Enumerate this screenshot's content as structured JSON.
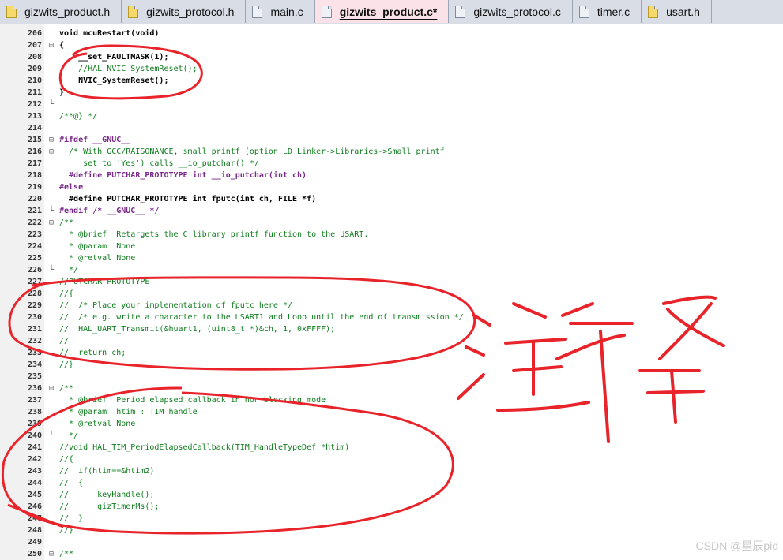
{
  "tabs": [
    {
      "label": "gizwits_product.h",
      "type": "h",
      "active": false
    },
    {
      "label": "gizwits_protocol.h",
      "type": "h",
      "active": false
    },
    {
      "label": "main.c",
      "type": "c",
      "active": false
    },
    {
      "label": "gizwits_product.c*",
      "type": "c",
      "active": true
    },
    {
      "label": "gizwits_protocol.c",
      "type": "c",
      "active": false
    },
    {
      "label": "timer.c",
      "type": "c",
      "active": false
    },
    {
      "label": "usart.h",
      "type": "h",
      "active": false
    }
  ],
  "lines": [
    {
      "n": "206",
      "fold": "",
      "code": "void mcuRestart(void)",
      "cls": "code"
    },
    {
      "n": "207",
      "fold": "⊟",
      "code": "{",
      "cls": "code"
    },
    {
      "n": "208",
      "fold": "",
      "code": "    __set_FAULTMASK(1);",
      "cls": "code"
    },
    {
      "n": "209",
      "fold": "",
      "code": "    //HAL_NVIC_SystemReset();",
      "cls": "cm"
    },
    {
      "n": "210",
      "fold": "",
      "code": "    NVIC_SystemReset();",
      "cls": "code"
    },
    {
      "n": "211",
      "fold": "",
      "code": "}",
      "cls": "code"
    },
    {
      "n": "212",
      "fold": "└",
      "code": "",
      "cls": "code"
    },
    {
      "n": "213",
      "fold": "",
      "code": "/**@} */",
      "cls": "cm"
    },
    {
      "n": "214",
      "fold": "",
      "code": "",
      "cls": "code"
    },
    {
      "n": "215",
      "fold": "⊟",
      "code": "#ifdef __GNUC__",
      "cls": "pp"
    },
    {
      "n": "216",
      "fold": "⊟",
      "code": "  /* With GCC/RAISONANCE, small printf (option LD Linker->Libraries->Small printf",
      "cls": "cm"
    },
    {
      "n": "217",
      "fold": "",
      "code": "     set to 'Yes') calls __io_putchar() */",
      "cls": "cm"
    },
    {
      "n": "218",
      "fold": "",
      "code": "  #define PUTCHAR_PROTOTYPE int __io_putchar(int ch)",
      "cls": "pp"
    },
    {
      "n": "219",
      "fold": "",
      "code": "#else",
      "cls": "pp"
    },
    {
      "n": "220",
      "fold": "",
      "code": "  #define PUTCHAR_PROTOTYPE int fputc(int ch, FILE *f)",
      "cls": "code"
    },
    {
      "n": "221",
      "fold": "└",
      "code": "#endif /* __GNUC__ */",
      "cls": "pp"
    },
    {
      "n": "222",
      "fold": "⊟",
      "code": "/**",
      "cls": "cm"
    },
    {
      "n": "223",
      "fold": "",
      "code": "  * @brief  Retargets the C library printf function to the USART.",
      "cls": "cm"
    },
    {
      "n": "224",
      "fold": "",
      "code": "  * @param  None",
      "cls": "cm"
    },
    {
      "n": "225",
      "fold": "",
      "code": "  * @retval None",
      "cls": "cm"
    },
    {
      "n": "226",
      "fold": "└",
      "code": "  */",
      "cls": "cm"
    },
    {
      "n": "227",
      "fold": "",
      "code": "//PUTCHAR_PROTOTYPE",
      "cls": "cm"
    },
    {
      "n": "228",
      "fold": "",
      "code": "//{",
      "cls": "cm"
    },
    {
      "n": "229",
      "fold": "",
      "code": "//  /* Place your implementation of fputc here */",
      "cls": "cm"
    },
    {
      "n": "230",
      "fold": "",
      "code": "//  /* e.g. write a character to the USART1 and Loop until the end of transmission */",
      "cls": "cm"
    },
    {
      "n": "231",
      "fold": "",
      "code": "//  HAL_UART_Transmit(&huart1, (uint8_t *)&ch, 1, 0xFFFF);",
      "cls": "cm"
    },
    {
      "n": "232",
      "fold": "",
      "code": "//",
      "cls": "cm"
    },
    {
      "n": "233",
      "fold": "",
      "code": "//  return ch;",
      "cls": "cm"
    },
    {
      "n": "234",
      "fold": "",
      "code": "//}",
      "cls": "cm"
    },
    {
      "n": "235",
      "fold": "",
      "code": "",
      "cls": "code"
    },
    {
      "n": "236",
      "fold": "⊟",
      "code": "/**",
      "cls": "cm"
    },
    {
      "n": "237",
      "fold": "",
      "code": "  * @brief  Period elapsed callback in non blocking mode",
      "cls": "cm"
    },
    {
      "n": "238",
      "fold": "",
      "code": "  * @param  htim : TIM handle",
      "cls": "cm"
    },
    {
      "n": "239",
      "fold": "",
      "code": "  * @retval None",
      "cls": "cm"
    },
    {
      "n": "240",
      "fold": "└",
      "code": "  */",
      "cls": "cm"
    },
    {
      "n": "241",
      "fold": "",
      "code": "//void HAL_TIM_PeriodElapsedCallback(TIM_HandleTypeDef *htim)",
      "cls": "cm"
    },
    {
      "n": "242",
      "fold": "",
      "code": "//{",
      "cls": "cm"
    },
    {
      "n": "243",
      "fold": "",
      "code": "//  if(htim==&htim2)",
      "cls": "cm"
    },
    {
      "n": "244",
      "fold": "",
      "code": "//  {",
      "cls": "cm"
    },
    {
      "n": "245",
      "fold": "",
      "code": "//      keyHandle();",
      "cls": "cm"
    },
    {
      "n": "246",
      "fold": "",
      "code": "//      gizTimerMs();",
      "cls": "cm"
    },
    {
      "n": "247",
      "fold": "",
      "code": "//  }",
      "cls": "cm"
    },
    {
      "n": "248",
      "fold": "",
      "code": "//}",
      "cls": "cm"
    },
    {
      "n": "249",
      "fold": "",
      "code": "",
      "cls": "code"
    },
    {
      "n": "250",
      "fold": "⊟",
      "code": "/**",
      "cls": "cm"
    }
  ],
  "annotation": {
    "label": "注释",
    "color": "#e8232a"
  },
  "watermark": "CSDN @星辰pid"
}
